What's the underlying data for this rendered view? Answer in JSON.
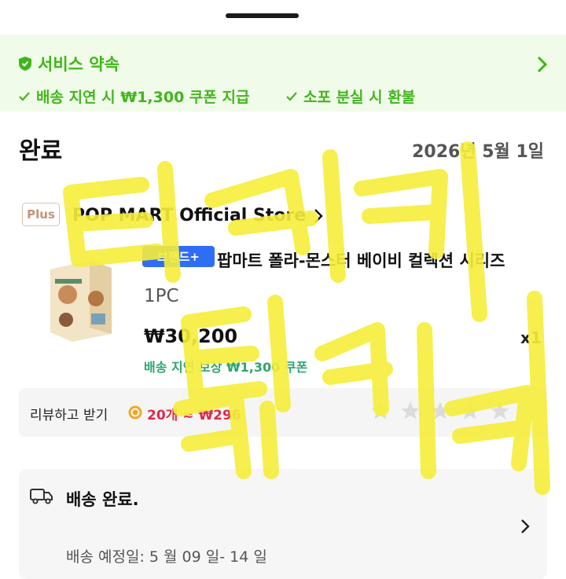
{
  "service": {
    "title": "서비스 약속",
    "promises": [
      {
        "label": "배송 지연 시 ₩1,300 쿠폰 지급"
      },
      {
        "label": "소포 분실 시 환불"
      }
    ]
  },
  "order": {
    "status": "완료",
    "date": "2026년 5월 1일"
  },
  "store": {
    "badge": "Plus",
    "name": "POP MART Official Store"
  },
  "product": {
    "brand_badge": "브랜드+",
    "name": "팝마트 폴라-몬스터 베이비 컬렉션 시리즈",
    "option": "1PC",
    "price": "₩30,200",
    "quantity": "x1",
    "compensation": "배송 지연 보상 ₩1,300 쿠폰"
  },
  "review": {
    "label": "리뷰하고 받기",
    "reward": "20개 ≈ ₩296",
    "star_count": 5
  },
  "shipping": {
    "status": "배송 완료.",
    "estimated": "배송 예정일: 5 월 09 일- 14 일"
  },
  "overlay": {
    "handwriting": "티키티키",
    "color": "#f6ee3a"
  },
  "colors": {
    "brand_green": "#3fb618",
    "service_bg": "#f1fbe9",
    "badge_blue": "#2f6df5",
    "reward_red": "#e0284a",
    "compensation_green": "#2fa56e"
  }
}
